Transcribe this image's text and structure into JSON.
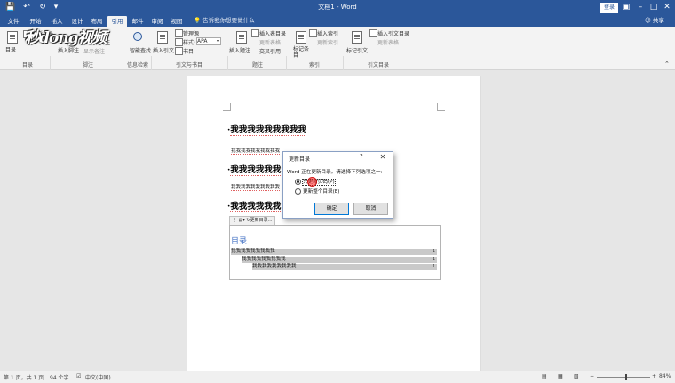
{
  "titlebar": {
    "title": "文档1 - Word",
    "login": "登录",
    "quick_access": [
      "save-icon",
      "undo-icon",
      "redo-icon",
      "customize-icon"
    ],
    "window_buttons": [
      "ribbon-display-icon",
      "minimize-icon",
      "maximize-icon",
      "close-icon"
    ]
  },
  "tabs": [
    {
      "label": "文件"
    },
    {
      "label": "开始"
    },
    {
      "label": "插入"
    },
    {
      "label": "设计"
    },
    {
      "label": "布局"
    },
    {
      "label": "引用",
      "active": true
    },
    {
      "label": "邮件"
    },
    {
      "label": "审阅"
    },
    {
      "label": "视图"
    }
  ],
  "tellme": "告诉我你想要做什么",
  "share": "共享",
  "ribbon": {
    "toc_label": "目录",
    "update_table": "更新目录",
    "insert_footnote": "插入脚注",
    "next_footnote": "下一条脚注",
    "show_notes": "显示备注",
    "smart_lookup": "智能查找",
    "insert_citation": "插入引文",
    "manage_sources": "管理源",
    "style_label": "样式:",
    "style_value": "APA",
    "bibliography": "书目",
    "insert_caption": "插入题注",
    "insert_table_of_figures": "插入表目录",
    "update_table_figures": "更新表格",
    "cross_reference": "交叉引用",
    "mark_entry": "标记条目",
    "insert_index": "插入索引",
    "update_index": "更新索引",
    "mark_citation": "标记引文",
    "insert_table_authorities": "插入引文目录",
    "update_table_authorities": "更新表格",
    "groups": {
      "toc": "目录",
      "footnotes": "脚注",
      "research": "信息检索",
      "citations": "引文与书目",
      "captions": "题注",
      "index": "索引",
      "authorities": "引文目录"
    }
  },
  "watermark": "秒dong视频",
  "document": {
    "heading1": "我我我我我我我我我",
    "body1": "我我我我我我我我我我",
    "heading2": "我我我我我我",
    "body2": "我我我我我我我我我我",
    "heading3": "我我我我我我",
    "toc_control_label": "更新目录...",
    "toc_title": "目录",
    "toc_entries": [
      {
        "text": "我我我我我我我我我",
        "page": "1"
      },
      {
        "text": "我我我我我我我我我",
        "page": "1"
      },
      {
        "text": "我我我我我我我我我",
        "page": "1"
      }
    ]
  },
  "dialog": {
    "title": "更新目录",
    "help": "?",
    "message": "Word 正在更新目录。请选择下列选项之一:",
    "option1": "只更新页码(P)",
    "option2": "更新整个目录(E)",
    "selected": "option1",
    "ok": "确定",
    "cancel": "取消"
  },
  "status": {
    "page": "第 1 页，共 1 页",
    "words": "94 个字",
    "language": "中文(中国)",
    "zoom": "84%",
    "zoom_percent": 84
  }
}
